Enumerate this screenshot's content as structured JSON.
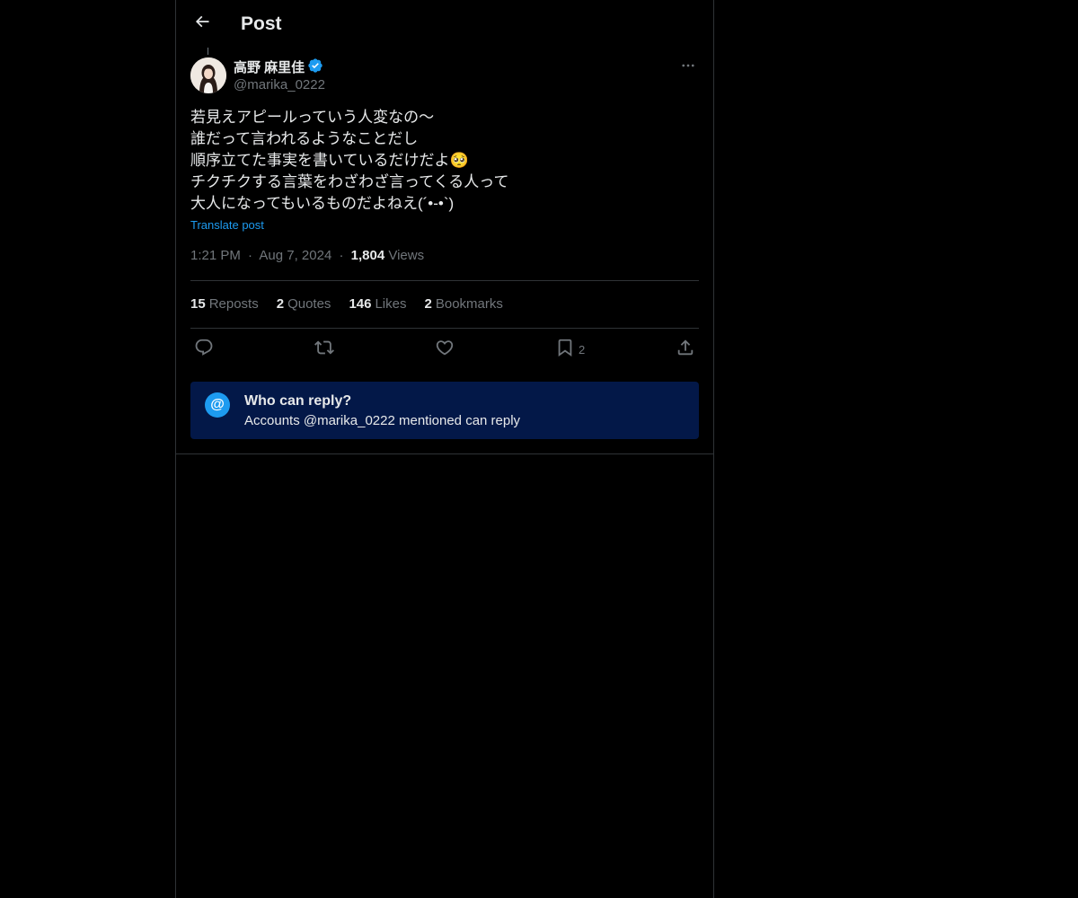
{
  "header": {
    "title": "Post",
    "back_icon": "arrow-left-icon"
  },
  "post": {
    "author": {
      "display_name": "高野 麻里佳",
      "handle": "@marika_0222",
      "verified": true,
      "verified_color": "#1d9bf0"
    },
    "text_lines": [
      "若見えアピールっていう人変なの〜",
      "誰だって言われるようなことだし",
      "順序立てた事実を書いているだけだよ🥺",
      "チクチクする言葉をわざわざ言ってくる人って",
      "大人になってもいるものだよねえ(´•-•`)"
    ],
    "translate_label": "Translate post",
    "time": "1:21 PM",
    "date": "Aug 7, 2024",
    "views_count": "1,804",
    "views_label": "Views",
    "separator": "·"
  },
  "stats": {
    "reposts_count": "15",
    "reposts_label": "Reposts",
    "quotes_count": "2",
    "quotes_label": "Quotes",
    "likes_count": "146",
    "likes_label": "Likes",
    "bookmarks_count": "2",
    "bookmarks_label": "Bookmarks"
  },
  "actions": {
    "bookmark_count": "2"
  },
  "reply_restriction": {
    "title": "Who can reply?",
    "description": "Accounts @marika_0222 mentioned can reply",
    "icon_glyph": "@",
    "background_color": "#031848",
    "accent_color": "#1d9bf0"
  },
  "colors": {
    "background": "#000000",
    "text_primary": "#e7e9ea",
    "text_secondary": "#71767b",
    "link": "#1d9bf0",
    "border": "#2f3336"
  }
}
